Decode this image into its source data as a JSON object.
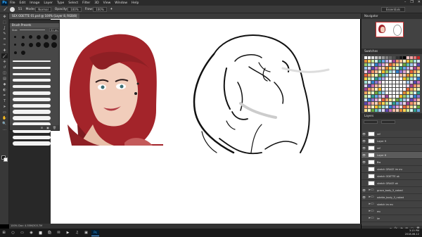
{
  "app": {
    "logo": "Ps",
    "menu": [
      "File",
      "Edit",
      "Image",
      "Layer",
      "Type",
      "Select",
      "Filter",
      "3D",
      "View",
      "Window",
      "Help"
    ],
    "window_controls": [
      "–",
      "❐",
      "✕"
    ]
  },
  "options_bar": {
    "brush_size": "51",
    "mode_label": "Mode:",
    "mode_value": "Normal",
    "opacity_label": "Opacity:",
    "opacity_value": "100%",
    "flow_label": "Flow:",
    "flow_value": "100%",
    "workspace": "Essentials"
  },
  "document": {
    "tab_title": "SEX ODETTE 01.psd @ 100% (Layer 8, RGB/8)",
    "status": "100%   Doc: 4.55M/303.7M"
  },
  "tools": [
    "move-icon",
    "marquee-icon",
    "lasso-icon",
    "quick-select-icon",
    "crop-icon",
    "eyedropper-icon",
    "healing-icon",
    "brush-icon",
    "clone-stamp-icon",
    "history-brush-icon",
    "eraser-icon",
    "gradient-icon",
    "blur-icon",
    "dodge-icon",
    "pen-icon",
    "type-icon",
    "path-select-icon",
    "shape-icon",
    "hand-icon",
    "zoom-icon",
    "more-icon"
  ],
  "tool_glyphs": [
    "✥",
    "⬚",
    "ʆ",
    "✎",
    "⌗",
    "✑",
    "✚",
    "🖌",
    "⎈",
    "↺",
    "◫",
    "▤",
    "◆",
    "◐",
    "✒",
    "T",
    "➤",
    "▭",
    "✋",
    "🔍",
    "…"
  ],
  "active_tool_index": 7,
  "brush_panel": {
    "title": "Brush Presets",
    "size_label": "Size:",
    "size_value": "51 px",
    "tip_sizes": [
      3,
      4,
      5,
      6,
      7,
      8,
      3,
      5,
      6,
      7,
      8,
      8,
      4,
      6
    ],
    "stroke_widths": [
      2,
      3,
      3,
      4,
      4,
      5,
      5,
      5,
      6,
      6,
      6,
      6,
      5,
      6
    ],
    "footer_icons": [
      "⊞",
      "▣",
      "🗑"
    ]
  },
  "dock": {
    "navigator_tab": "Navigator",
    "swatches_tab": "Swatches",
    "layers_tab": "Layers",
    "layers_footer_icons": [
      "∞",
      "fx",
      "◑",
      "▥",
      "▢",
      "🗑"
    ],
    "layers": [
      {
        "name": "ref",
        "visible": true,
        "folder": false,
        "selected": false
      },
      {
        "name": "Layer 9",
        "visible": true,
        "folder": false,
        "selected": false
      },
      {
        "name": "ref",
        "visible": true,
        "folder": false,
        "selected": false
      },
      {
        "name": "Layer 8",
        "visible": true,
        "folder": false,
        "selected": true
      },
      {
        "name": "Bw",
        "visible": true,
        "folder": false,
        "selected": false
      },
      {
        "name": "sketch GRACE im mc",
        "visible": false,
        "folder": false,
        "selected": false
      },
      {
        "name": "sketch ODETTE ok",
        "visible": false,
        "folder": false,
        "selected": false
      },
      {
        "name": "sketch GRACE ok",
        "visible": false,
        "folder": false,
        "selected": false
      },
      {
        "name": "grace_body_5_naked",
        "visible": true,
        "folder": true,
        "selected": false
      },
      {
        "name": "odette_body_5_naked",
        "visible": true,
        "folder": true,
        "selected": false
      },
      {
        "name": "sketch im mc",
        "visible": false,
        "folder": true,
        "selected": false
      },
      {
        "name": "mc",
        "visible": false,
        "folder": true,
        "selected": false
      },
      {
        "name": "im",
        "visible": false,
        "folder": true,
        "selected": false
      }
    ]
  },
  "swatch_colors": [
    "#ffffff",
    "#f2f2f2",
    "#e0e0e0",
    "#cccccc",
    "#b3b3b3",
    "#999999",
    "#808080",
    "#666666",
    "#4d4d4d",
    "#333333",
    "#1a1a1a",
    "#000000",
    "#f7c6c6",
    "#f4a8a8",
    "#e57373",
    "#c62828"
  ],
  "swatch_wheel": [
    "#fde0d6",
    "#f9b8a1",
    "#f58e6b",
    "#e8613a",
    "#f7d3b7",
    "#f6bf8f",
    "#f3a562",
    "#e28a36",
    "#fff3c4",
    "#ffe38a",
    "#ffd54f",
    "#f9c02e",
    "#e9f6c9",
    "#c9e89b",
    "#9ccc65",
    "#6aa83a",
    "#d2f1ec",
    "#a2e1d6",
    "#5fc3b3",
    "#2e9c8c",
    "#d1e6f8",
    "#a3ccf1",
    "#64a8e6",
    "#2e7fcc",
    "#dcd4f2",
    "#b7a8e6",
    "#8b74d3",
    "#5e47b0",
    "#efd2ea",
    "#e0a6d5",
    "#c972b9",
    "#a14393"
  ],
  "taskbar": {
    "icons": [
      "windows-icon",
      "search-icon",
      "task-view-icon",
      "chrome-icon",
      "folder-icon",
      "store-icon",
      "mail-icon",
      "media-icon",
      "music-icon",
      "app-icon",
      "photoshop-icon"
    ],
    "glyphs": [
      "⊞",
      "○",
      "▭",
      "◉",
      "▆",
      "🛍",
      "✉",
      "▶",
      "♫",
      "▣",
      "Ps"
    ],
    "active_index": 10,
    "time": "3:15 PM",
    "date": "2018-06-12"
  }
}
